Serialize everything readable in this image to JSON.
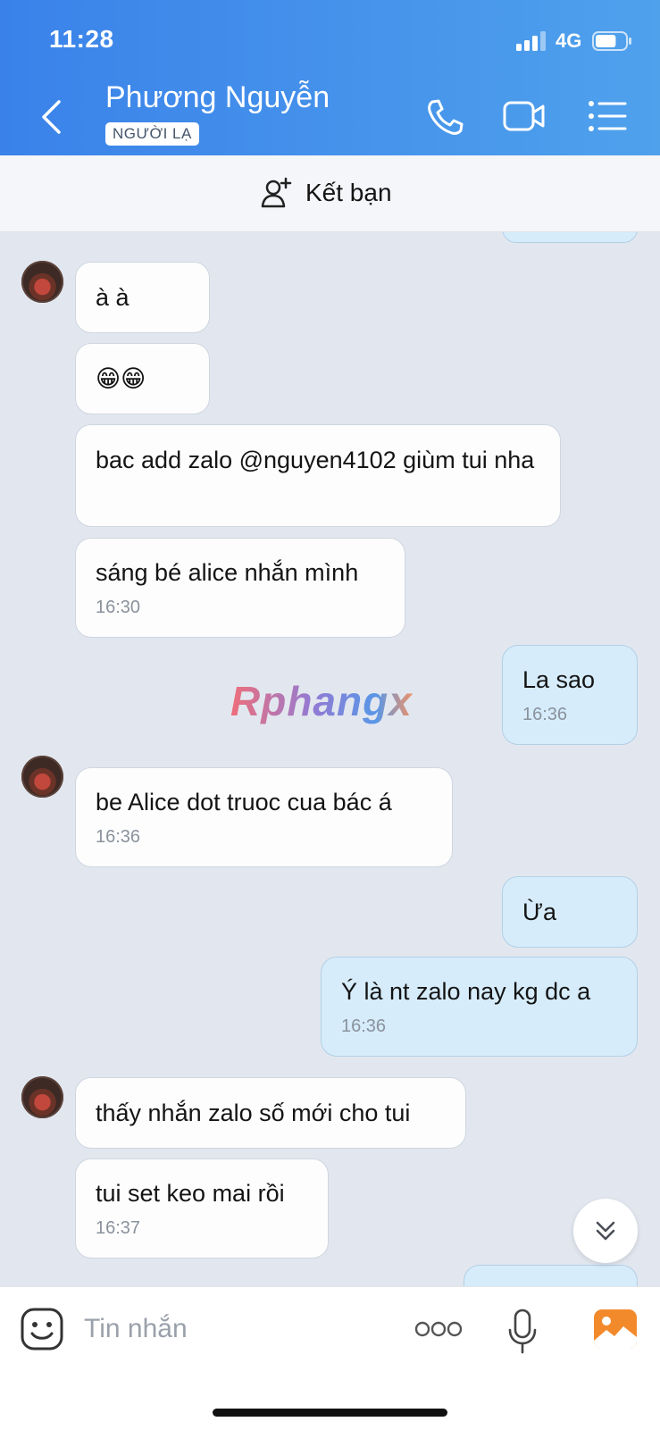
{
  "status_bar": {
    "time": "11:28",
    "network": "4G",
    "battery_level": 0.7
  },
  "header": {
    "contact_name": "Phương Nguyễn",
    "badge": "NGƯỜI LẠ",
    "icons": [
      "back-arrow-icon",
      "phone-icon",
      "video-camera-icon",
      "list-menu-icon"
    ]
  },
  "add_friend": {
    "label": "Kết bạn",
    "icon": "add-user-icon"
  },
  "messages": [
    {
      "from": "them",
      "text": "à à",
      "time": ""
    },
    {
      "from": "them",
      "text": "😁😁",
      "time": ""
    },
    {
      "from": "them",
      "text": "bac add zalo @nguyen4102 giùm tui nha",
      "time": ""
    },
    {
      "from": "them",
      "text": "sáng bé alice nhắn mình",
      "time": "16:30"
    },
    {
      "from": "me",
      "text": "La sao",
      "time": "16:36"
    },
    {
      "from": "them",
      "text": "be Alice dot truoc cua bác á",
      "time": "16:36"
    },
    {
      "from": "me",
      "text": "Ừa",
      "time": ""
    },
    {
      "from": "me",
      "text": "Ý là nt zalo nay kg dc a",
      "time": "16:36"
    },
    {
      "from": "them",
      "text": "thấy nhắn zalo số mới cho tui",
      "time": ""
    },
    {
      "from": "them",
      "text": "tui set keo mai rồi",
      "time": "16:37"
    }
  ],
  "watermark": "Rphangx",
  "composer": {
    "placeholder": "Tin nhắn",
    "icons": [
      "sticker-icon",
      "more-options-icon",
      "microphone-icon",
      "image-gallery-icon"
    ]
  },
  "colors": {
    "header_start": "#3a82ea",
    "header_end": "#4fa1ec",
    "my_bubble": "#d6ecfb",
    "chat_bg": "#e2e7ef"
  }
}
